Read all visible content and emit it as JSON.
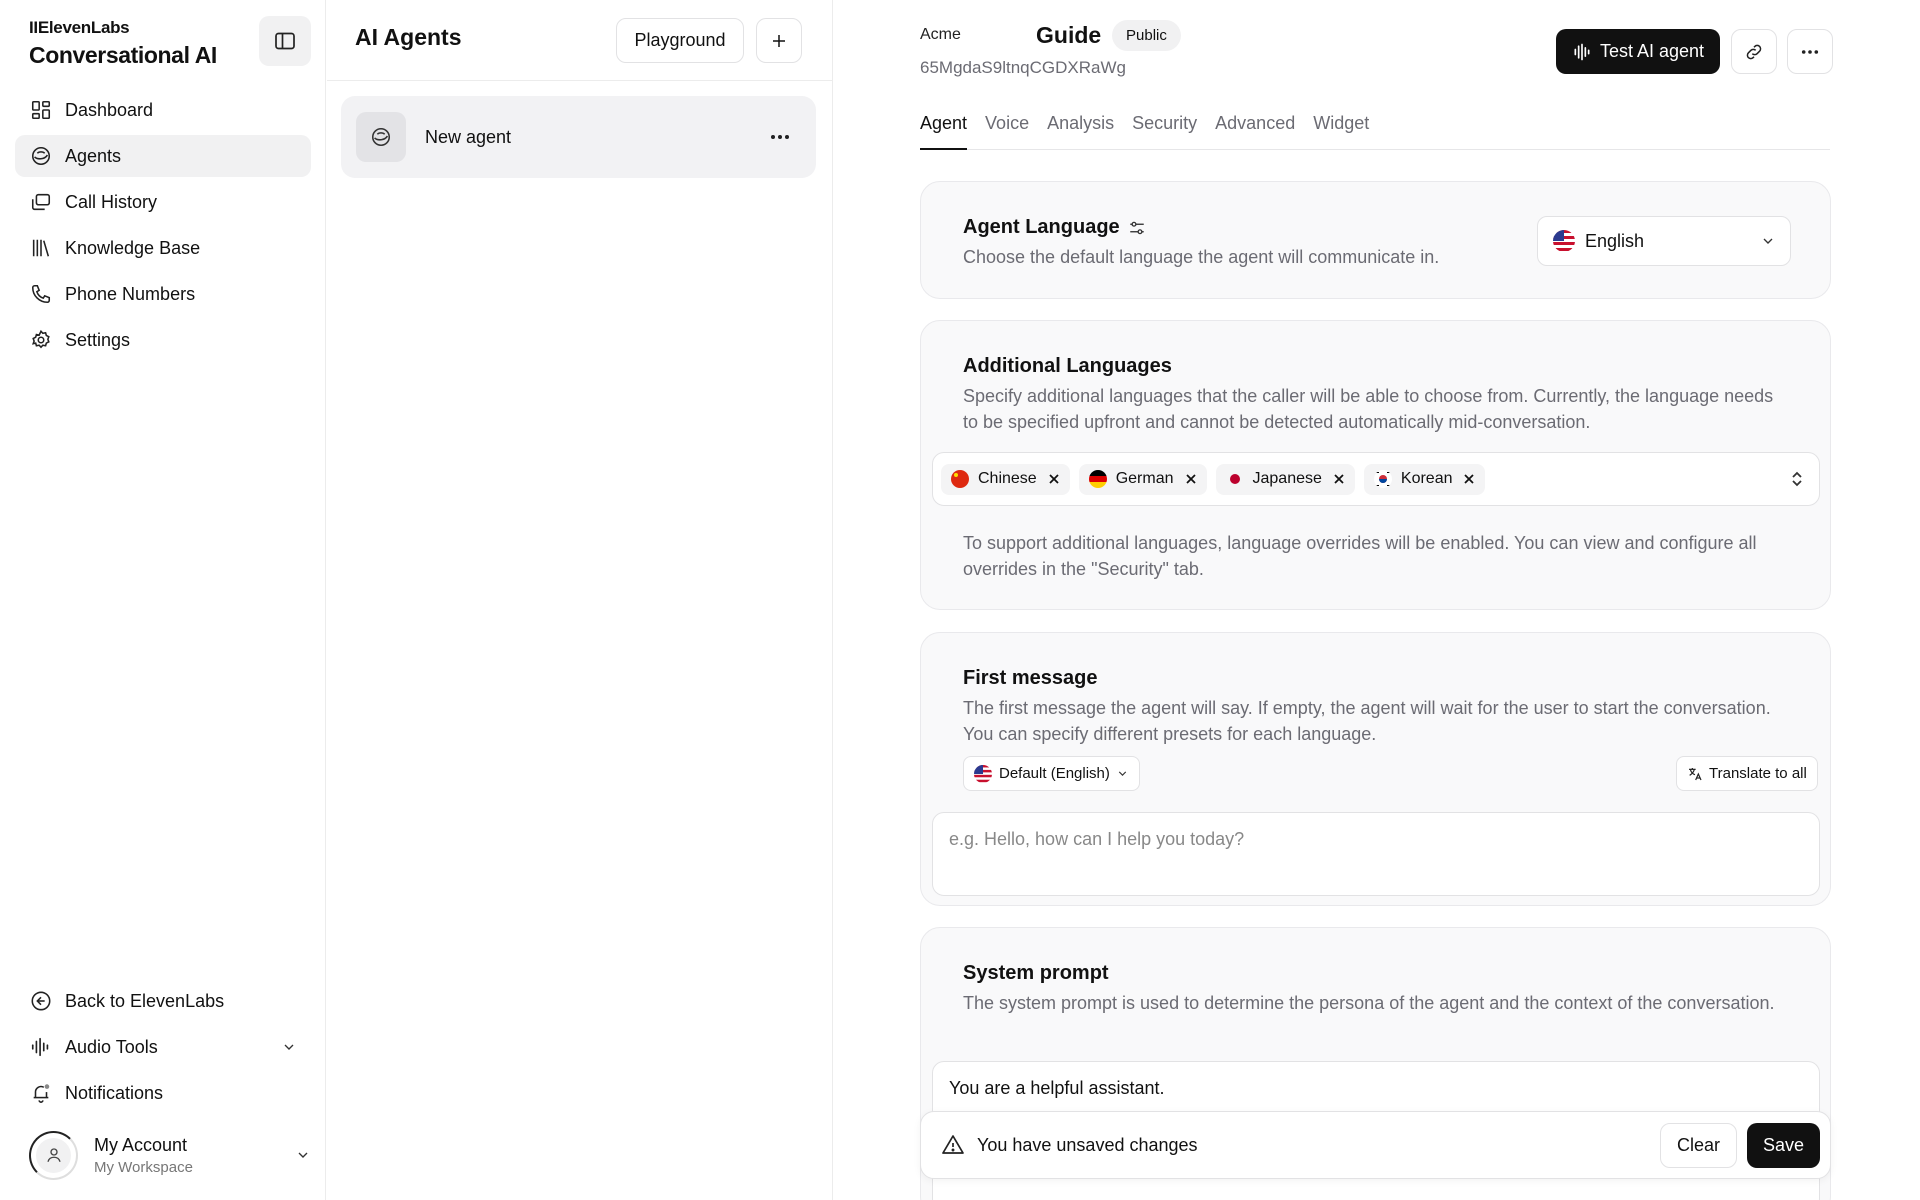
{
  "sidebar": {
    "brand_small": "IIElevenLabs",
    "brand_title": "Conversational AI",
    "nav": [
      {
        "label": "Dashboard",
        "icon": "dashboard-icon"
      },
      {
        "label": "Agents",
        "icon": "agents-icon",
        "active": true
      },
      {
        "label": "Call History",
        "icon": "call-history-icon"
      },
      {
        "label": "Knowledge Base",
        "icon": "knowledge-base-icon"
      },
      {
        "label": "Phone Numbers",
        "icon": "phone-icon"
      },
      {
        "label": "Settings",
        "icon": "gear-icon"
      }
    ],
    "bottom": [
      {
        "label": "Back to ElevenLabs",
        "icon": "back-arrow-icon"
      },
      {
        "label": "Audio Tools",
        "icon": "audio-waveform-icon"
      },
      {
        "label": "Notifications",
        "icon": "bell-icon"
      }
    ],
    "account": {
      "name": "My Account",
      "workspace": "My Workspace"
    }
  },
  "agents_panel": {
    "title": "AI Agents",
    "playground_label": "Playground",
    "agents": [
      {
        "name": "New agent"
      }
    ]
  },
  "header": {
    "org": "Acme",
    "agent_name": "Guide",
    "visibility": "Public",
    "agent_id": "65MgdaS9ltnqCGDXRaWg",
    "test_button": "Test AI agent"
  },
  "tabs": [
    {
      "label": "Agent",
      "active": true
    },
    {
      "label": "Voice"
    },
    {
      "label": "Analysis"
    },
    {
      "label": "Security"
    },
    {
      "label": "Advanced"
    },
    {
      "label": "Widget"
    }
  ],
  "agent_language": {
    "title": "Agent Language",
    "description": "Choose the default language the agent will communicate in.",
    "selected": "English"
  },
  "additional_languages": {
    "title": "Additional Languages",
    "description": "Specify additional languages that the caller will be able to choose from. Currently, the language needs to be specified upfront and cannot be detected automatically mid-conversation.",
    "selected": [
      {
        "label": "Chinese",
        "flag": "cn"
      },
      {
        "label": "German",
        "flag": "de"
      },
      {
        "label": "Japanese",
        "flag": "jp"
      },
      {
        "label": "Korean",
        "flag": "kr"
      }
    ],
    "note": "To support additional languages, language overrides will be enabled. You can view and configure all overrides in the \"Security\" tab."
  },
  "first_message": {
    "title": "First message",
    "description": "The first message the agent will say. If empty, the agent will wait for the user to start the conversation. You can specify different presets for each language.",
    "preset_label": "Default (English)",
    "translate_label": "Translate to all",
    "placeholder": "e.g. Hello, how can I help you today?"
  },
  "system_prompt": {
    "title": "System prompt",
    "description": "The system prompt is used to determine the persona of the agent and the context of the conversation.",
    "value": "You are a helpful assistant."
  },
  "unsaved_bar": {
    "message": "You have unsaved changes",
    "clear_label": "Clear",
    "save_label": "Save"
  },
  "colors": {
    "accent": "#111111",
    "muted_text": "#6b6b73",
    "card_bg": "#f9f9fa",
    "active_bg": "#f1f1f2"
  }
}
